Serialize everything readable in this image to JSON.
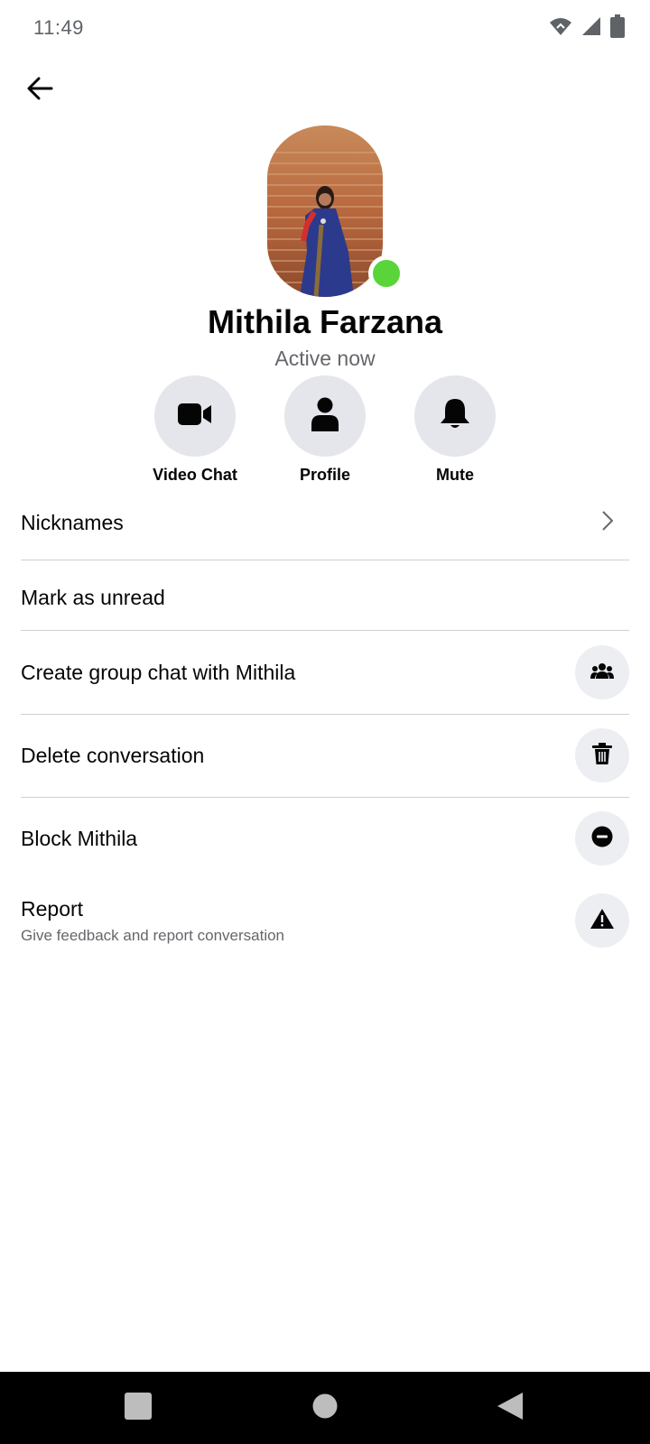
{
  "status_bar": {
    "time": "11:49",
    "icons": [
      "wifi-icon",
      "cellular-signal-icon",
      "battery-icon"
    ]
  },
  "header": {
    "back_icon": "arrow-left-icon"
  },
  "profile": {
    "name": "Mithila Farzana",
    "status": "Active now",
    "online_color": "#5ad539"
  },
  "actions": [
    {
      "label": "Video Chat",
      "icon": "video-camera-icon"
    },
    {
      "label": "Profile",
      "icon": "person-icon"
    },
    {
      "label": "Mute",
      "icon": "bell-icon"
    }
  ],
  "menu": {
    "nicknames": {
      "label": "Nicknames",
      "icon": "chevron-right-icon"
    },
    "mark_unread": {
      "label": "Mark as unread"
    },
    "create_group": {
      "label": "Create group chat with Mithila",
      "icon": "group-icon"
    },
    "delete": {
      "label": "Delete conversation",
      "icon": "trash-icon"
    },
    "block": {
      "label": "Block Mithila",
      "icon": "minus-circle-icon"
    },
    "report": {
      "label": "Report",
      "sublabel": "Give feedback and report conversation",
      "icon": "warning-icon"
    }
  },
  "nav_bar": {
    "icons": [
      "recents-square-icon",
      "home-circle-icon",
      "back-triangle-icon"
    ]
  },
  "colors": {
    "accent_gray": "#e4e6eb",
    "text_primary": "#050505",
    "text_secondary": "#65676b"
  }
}
